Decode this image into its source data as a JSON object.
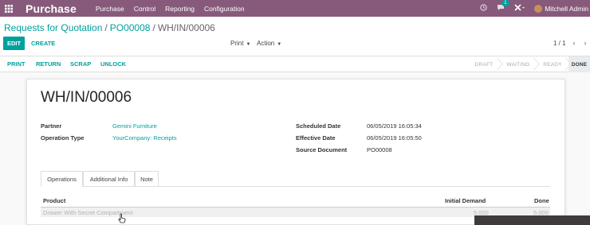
{
  "navbar": {
    "brand": "Purchase",
    "menu": [
      "Purchase",
      "Control",
      "Reporting",
      "Configuration"
    ],
    "messages_badge": "1",
    "user": "Mitchell Admin",
    "bg_color": "#875a7b"
  },
  "breadcrumb": {
    "first": "Requests for Quotation",
    "second": "PO00008",
    "current": "WH/IN/00006",
    "separator": "/"
  },
  "control": {
    "edit": "EDIT",
    "create": "CREATE",
    "print": "Print",
    "action": "Action",
    "pager": "1 / 1",
    "prev_icon": "‹",
    "next_icon": "›"
  },
  "statusbar": {
    "buttons": [
      "PRINT",
      "RETURN",
      "SCRAP",
      "UNLOCK"
    ],
    "stages": [
      "DRAFT",
      "WAITING",
      "READY",
      "DONE"
    ],
    "active_stage": "DONE"
  },
  "record": {
    "name": "WH/IN/00006",
    "partner_label": "Partner",
    "partner": "Gemini Furniture",
    "operation_type_label": "Operation Type",
    "operation_type": "YourCompany: Receipts",
    "scheduled_label": "Scheduled Date",
    "scheduled": "06/05/2019 16:05:34",
    "effective_label": "Effective Date",
    "effective": "06/05/2019 16:05:50",
    "source_label": "Source Document",
    "source": "PO00008"
  },
  "tabs": [
    "Operations",
    "Additional Info",
    "Note"
  ],
  "operations_table": {
    "columns": [
      "Product",
      "Initial Demand",
      "Done"
    ],
    "rows": [
      {
        "product": "Drawer With Secret Compartment",
        "initial_demand": "5.000",
        "done": "5.000"
      }
    ]
  },
  "colors": {
    "accent": "#00a09d",
    "primary": "#875a7b"
  }
}
